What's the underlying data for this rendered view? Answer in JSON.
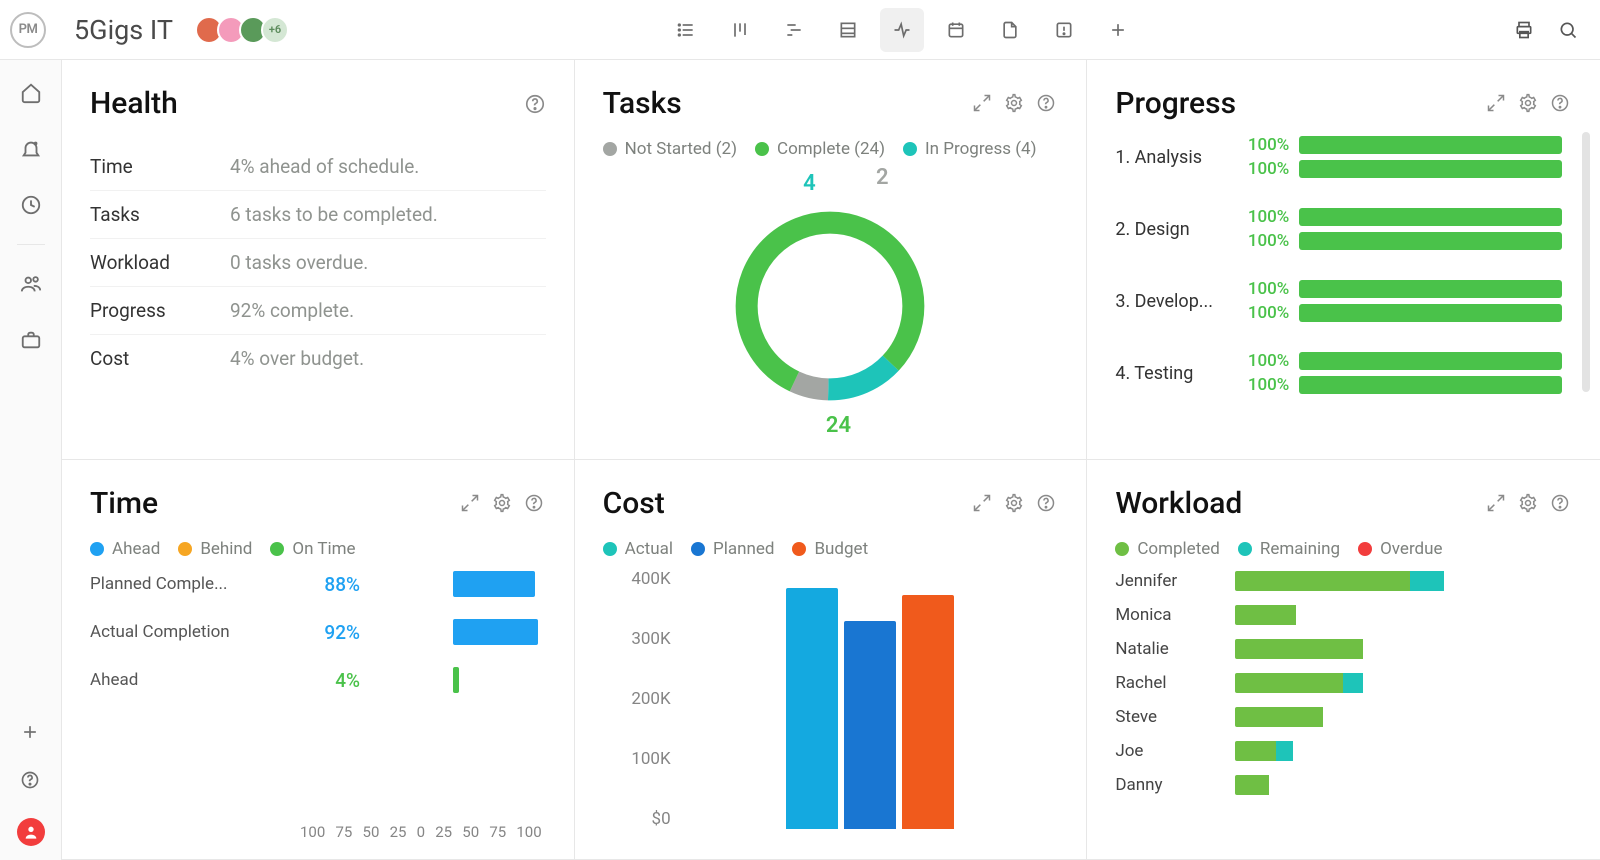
{
  "page_title": "5Gigs IT",
  "avatars": [
    {
      "bg": "#e06a4c"
    },
    {
      "bg": "#f49bbb"
    },
    {
      "bg": "#5a9a5a"
    }
  ],
  "avatar_overflow": "+6",
  "view_tabs": [
    "list",
    "board",
    "gantt",
    "sheet",
    "status",
    "calendar",
    "files",
    "issues",
    "add"
  ],
  "active_view": "status",
  "sidebar_icons": [
    "home",
    "bell",
    "clock",
    "sep",
    "team",
    "briefcase"
  ],
  "panels": {
    "health": {
      "title": "Health",
      "rows": [
        {
          "label": "Time",
          "value": "4% ahead of schedule."
        },
        {
          "label": "Tasks",
          "value": "6 tasks to be completed."
        },
        {
          "label": "Workload",
          "value": "0 tasks overdue."
        },
        {
          "label": "Progress",
          "value": "92% complete."
        },
        {
          "label": "Cost",
          "value": "4% over budget."
        }
      ]
    },
    "tasks": {
      "title": "Tasks",
      "legend": [
        {
          "label": "Not Started (2)",
          "color": "#a3a6a3",
          "count": 2
        },
        {
          "label": "Complete (24)",
          "color": "#4ac24a",
          "count": 24
        },
        {
          "label": "In Progress (4)",
          "color": "#1ec4b9",
          "count": 4
        }
      ],
      "donut_labels": [
        {
          "text": "4",
          "color": "#1ec4b9",
          "top": "2%",
          "left": "44%"
        },
        {
          "text": "2",
          "color": "#a3a6a3",
          "top": "0%",
          "left": "60%"
        },
        {
          "text": "24",
          "color": "#4ac24a",
          "top": "88%",
          "left": "49%"
        }
      ]
    },
    "progress": {
      "title": "Progress",
      "items": [
        {
          "name": "1. Analysis",
          "pct1": "100%",
          "pct2": "100%"
        },
        {
          "name": "2. Design",
          "pct1": "100%",
          "pct2": "100%"
        },
        {
          "name": "3. Develop...",
          "pct1": "100%",
          "pct2": "100%"
        },
        {
          "name": "4. Testing",
          "pct1": "100%",
          "pct2": "100%"
        }
      ]
    },
    "time": {
      "title": "Time",
      "legend": [
        {
          "label": "Ahead",
          "color": "#1fa1f2"
        },
        {
          "label": "Behind",
          "color": "#f6a623"
        },
        {
          "label": "On Time",
          "color": "#4ac24a"
        }
      ],
      "rows": [
        {
          "label": "Planned Comple...",
          "pct": "88%",
          "color": "#1fa1f2",
          "value": 88
        },
        {
          "label": "Actual Completion",
          "pct": "92%",
          "color": "#1fa1f2",
          "value": 92
        },
        {
          "label": "Ahead",
          "pct": "4%",
          "color": "#4ac24a",
          "value": 4
        }
      ],
      "axis": [
        "100",
        "75",
        "50",
        "25",
        "0",
        "25",
        "50",
        "75",
        "100"
      ]
    },
    "cost": {
      "title": "Cost",
      "legend": [
        {
          "label": "Actual",
          "color": "#1ec4b9"
        },
        {
          "label": "Planned",
          "color": "#1976d2"
        },
        {
          "label": "Budget",
          "color": "#f05a1c"
        }
      ],
      "y_ticks": [
        "400K",
        "300K",
        "200K",
        "100K",
        "$0"
      ],
      "bars": [
        {
          "name": "Actual",
          "value": 365000,
          "color": "#14a9e0"
        },
        {
          "name": "Planned",
          "value": 315000,
          "color": "#1976d2"
        },
        {
          "name": "Budget",
          "value": 355000,
          "color": "#f05a1c"
        }
      ],
      "y_max": 400000
    },
    "workload": {
      "title": "Workload",
      "legend": [
        {
          "label": "Completed",
          "color": "#6fbf44"
        },
        {
          "label": "Remaining",
          "color": "#1ec4b9"
        },
        {
          "label": "Overdue",
          "color": "#f23d3d"
        }
      ],
      "rows": [
        {
          "name": "Jennifer",
          "completed": 52,
          "remaining": 10,
          "overdue": 0
        },
        {
          "name": "Monica",
          "completed": 18,
          "remaining": 0,
          "overdue": 0
        },
        {
          "name": "Natalie",
          "completed": 38,
          "remaining": 0,
          "overdue": 0
        },
        {
          "name": "Rachel",
          "completed": 32,
          "remaining": 6,
          "overdue": 0
        },
        {
          "name": "Steve",
          "completed": 26,
          "remaining": 0,
          "overdue": 0
        },
        {
          "name": "Joe",
          "completed": 12,
          "remaining": 5,
          "overdue": 0
        },
        {
          "name": "Danny",
          "completed": 10,
          "remaining": 0,
          "overdue": 0
        }
      ],
      "max": 100
    }
  },
  "chart_data": [
    {
      "type": "pie",
      "title": "Tasks",
      "series": [
        {
          "name": "Not Started",
          "value": 2
        },
        {
          "name": "Complete",
          "value": 24
        },
        {
          "name": "In Progress",
          "value": 4
        }
      ]
    },
    {
      "type": "bar",
      "title": "Time",
      "categories": [
        "Planned Completion",
        "Actual Completion",
        "Ahead"
      ],
      "values": [
        88,
        92,
        4
      ],
      "xlabel": "",
      "ylabel": "%",
      "ylim": [
        -100,
        100
      ]
    },
    {
      "type": "bar",
      "title": "Cost",
      "categories": [
        "Actual",
        "Planned",
        "Budget"
      ],
      "values": [
        365000,
        315000,
        355000
      ],
      "xlabel": "",
      "ylabel": "$",
      "ylim": [
        0,
        400000
      ]
    },
    {
      "type": "bar",
      "title": "Workload",
      "categories": [
        "Jennifer",
        "Monica",
        "Natalie",
        "Rachel",
        "Steve",
        "Joe",
        "Danny"
      ],
      "series": [
        {
          "name": "Completed",
          "values": [
            52,
            18,
            38,
            32,
            26,
            12,
            10
          ]
        },
        {
          "name": "Remaining",
          "values": [
            10,
            0,
            0,
            6,
            0,
            5,
            0
          ]
        },
        {
          "name": "Overdue",
          "values": [
            0,
            0,
            0,
            0,
            0,
            0,
            0
          ]
        }
      ]
    }
  ]
}
